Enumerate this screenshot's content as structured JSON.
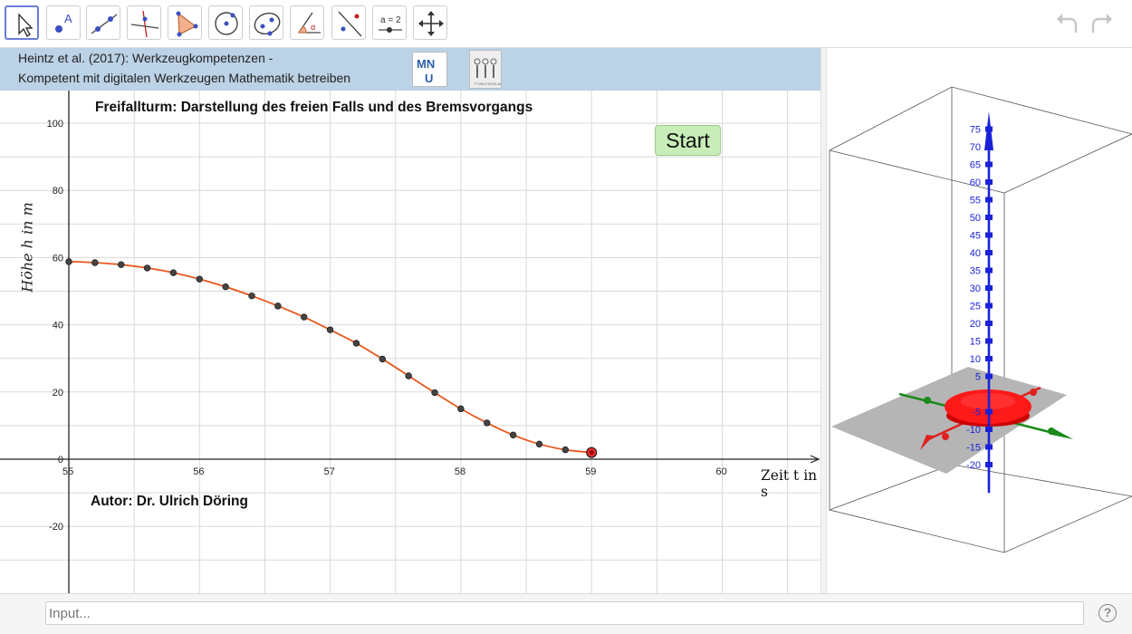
{
  "toolbar": {
    "tools": [
      {
        "name": "move",
        "icon": "arrow-pointer-icon",
        "selected": true
      },
      {
        "name": "point",
        "icon": "point-icon"
      },
      {
        "name": "line",
        "icon": "line-icon"
      },
      {
        "name": "perpendicular-line",
        "icon": "perpendicular-line-icon"
      },
      {
        "name": "polygon",
        "icon": "polygon-icon"
      },
      {
        "name": "circle-center-point",
        "icon": "circle-icon"
      },
      {
        "name": "ellipse",
        "icon": "ellipse-icon"
      },
      {
        "name": "angle",
        "icon": "angle-icon"
      },
      {
        "name": "reflect",
        "icon": "reflect-icon"
      },
      {
        "name": "slider",
        "icon": "slider-icon",
        "label": "a = 2"
      },
      {
        "name": "move-graphics-view",
        "icon": "move-view-icon"
      }
    ],
    "undo_icon": "undo-icon",
    "redo_icon": "redo-icon"
  },
  "banner": {
    "line1": "Heintz et al. (2017): Werkzeugkompetenzen -",
    "line2": "Kompetent mit digitalen Werkzeugen Mathematik betreiben",
    "logo1_text": "MNU",
    "logo2_text": "T³ DEUTSCHLAND"
  },
  "graphics": {
    "title": "Freifallturm: Darstellung des freien Falls und des Bremsvorgangs",
    "author": "Autor: Dr. Ulrich Döring",
    "start_button": "Start",
    "xlabel": "Zeit t in s",
    "ylabel": "Höhe h in m"
  },
  "chart_data": {
    "type": "line",
    "xlabel": "Zeit t in s",
    "ylabel": "Höhe h in m",
    "title": "Freifallturm: Darstellung des freien Falls und des Bremsvorgangs",
    "xlim": [
      54.9,
      61.3
    ],
    "ylim": [
      -40,
      110
    ],
    "x_ticks": [
      55,
      56,
      57,
      58,
      59,
      60
    ],
    "y_ticks": [
      -20,
      0,
      20,
      40,
      60,
      80,
      100
    ],
    "grid": true,
    "series": [
      {
        "color": "#e8571c",
        "curve": true,
        "points": [
          [
            55.0,
            58.8
          ],
          [
            55.2,
            58.5
          ],
          [
            55.4,
            57.9
          ],
          [
            55.6,
            56.9
          ],
          [
            55.8,
            55.5
          ],
          [
            56.0,
            53.6
          ],
          [
            56.2,
            51.3
          ],
          [
            56.4,
            48.6
          ],
          [
            56.6,
            45.6
          ],
          [
            56.8,
            42.3
          ],
          [
            57.0,
            38.5
          ],
          [
            57.2,
            34.5
          ],
          [
            57.4,
            29.8
          ],
          [
            57.6,
            24.8
          ],
          [
            57.8,
            19.8
          ],
          [
            58.0,
            15.0
          ],
          [
            58.2,
            10.8
          ],
          [
            58.4,
            7.2
          ],
          [
            58.6,
            4.5
          ],
          [
            58.8,
            2.8
          ],
          [
            59.0,
            2.0
          ]
        ]
      }
    ],
    "highlight_point": [
      59.0,
      2.0
    ],
    "point_color": "#444444",
    "highlight_color": "#e53030"
  },
  "view3d": {
    "z_tick_labels": [
      "75",
      "70",
      "65",
      "60",
      "55",
      "50",
      "45",
      "40",
      "35",
      "30",
      "25",
      "20",
      "15",
      "10",
      "5",
      "-5",
      "-10",
      "-15",
      "-20"
    ],
    "axis_colors": {
      "x": "#e02020",
      "y": "#1a8a1a",
      "z": "#1a22d8"
    },
    "object_color": "#ff1a1a"
  },
  "input_bar": {
    "placeholder": "Input...",
    "help_icon": "help-icon",
    "help_label": "?"
  }
}
